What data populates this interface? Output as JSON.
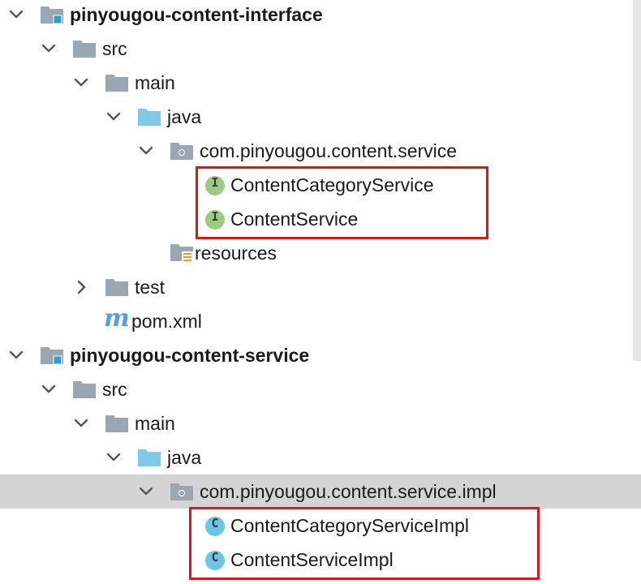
{
  "tree": [
    {
      "label": "pinyougou-content-interface",
      "icon": "module-folder-icon",
      "arrow": "down",
      "bold": true,
      "indent": 0
    },
    {
      "label": "src",
      "icon": "folder-icon",
      "arrow": "down",
      "indent": 1
    },
    {
      "label": "main",
      "icon": "folder-icon",
      "arrow": "down",
      "indent": 2
    },
    {
      "label": "java",
      "icon": "source-folder-icon",
      "arrow": "down",
      "indent": 3
    },
    {
      "label": "com.pinyougou.content.service",
      "icon": "package-icon",
      "arrow": "down",
      "indent": 4
    },
    {
      "label": "ContentCategoryService",
      "icon": "interface-icon",
      "badge": "I",
      "indent": 5
    },
    {
      "label": "ContentService",
      "icon": "interface-icon",
      "badge": "I",
      "indent": 5
    },
    {
      "label": "resources",
      "icon": "resources-folder-icon",
      "indent": 4
    },
    {
      "label": "test",
      "icon": "folder-icon",
      "arrow": "right",
      "indent": 2
    },
    {
      "label": "pom.xml",
      "icon": "maven-icon",
      "badge": "m",
      "indent": 2
    },
    {
      "label": "pinyougou-content-service",
      "icon": "module-folder-icon",
      "arrow": "down",
      "bold": true,
      "indent": 0
    },
    {
      "label": "src",
      "icon": "folder-icon",
      "arrow": "down",
      "indent": 1
    },
    {
      "label": "main",
      "icon": "folder-icon",
      "arrow": "down",
      "indent": 2
    },
    {
      "label": "java",
      "icon": "source-folder-icon",
      "arrow": "down",
      "indent": 3
    },
    {
      "label": "com.pinyougou.content.service.impl",
      "icon": "package-icon",
      "arrow": "down",
      "indent": 4,
      "selected": true
    },
    {
      "label": "ContentCategoryServiceImpl",
      "icon": "class-icon",
      "badge": "C",
      "indent": 5
    },
    {
      "label": "ContentServiceImpl",
      "icon": "class-icon",
      "badge": "C",
      "indent": 5
    }
  ],
  "colors": {
    "folder": "#9aa7b0",
    "source_folder": "#7fc8e8",
    "interface": "#9ccc82",
    "class": "#6cc4e6",
    "maven": "#4fa3d8",
    "module_dot": "#2aa1d6",
    "highlight": "#e3131b",
    "selection": "#d4d4d4"
  }
}
